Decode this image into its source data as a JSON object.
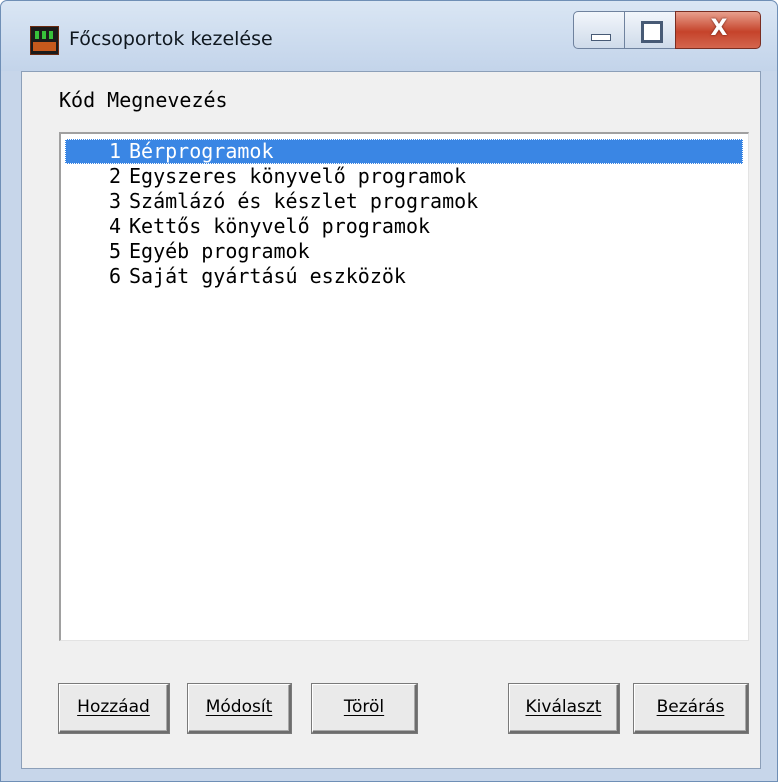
{
  "window": {
    "title": "Főcsoportok kezelése",
    "close_glyph": "X"
  },
  "list": {
    "header": "Kód Megnevezés",
    "rows": [
      {
        "code": "1",
        "name": "Bérprogramok",
        "selected": true
      },
      {
        "code": "2",
        "name": "Egyszeres könyvelő programok",
        "selected": false
      },
      {
        "code": "3",
        "name": "Számlázó és készlet programok",
        "selected": false
      },
      {
        "code": "4",
        "name": "Kettős könyvelő programok",
        "selected": false
      },
      {
        "code": "5",
        "name": "Egyéb programok",
        "selected": false
      },
      {
        "code": "6",
        "name": "Saját gyártású eszközök",
        "selected": false
      }
    ]
  },
  "buttons": {
    "add": "Hozzáad",
    "modify": "Módosít",
    "delete": "Töröl",
    "select": "Kiválaszt",
    "close": "Bezárás"
  },
  "colors": {
    "selection": "#3a86e4",
    "frame": "#c7d6ea",
    "close_button": "#c5432b"
  },
  "icons": {
    "app": "app-icon",
    "minimize": "minimize-icon",
    "maximize": "maximize-icon",
    "close": "close-icon"
  }
}
